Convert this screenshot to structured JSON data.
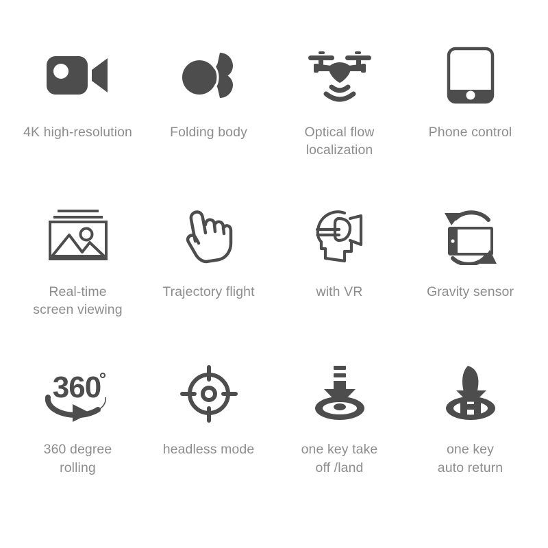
{
  "page": {
    "background_color": "#ffffff",
    "icon_color": "#4d4d4d",
    "label_color": "#8d8d8d"
  },
  "features": [
    {
      "icon": "video-camera-icon",
      "label": "4K high-resolution"
    },
    {
      "icon": "folding-body-icon",
      "label": "Folding body"
    },
    {
      "icon": "drone-optical-flow-icon",
      "label": "Optical flow\nlocalization"
    },
    {
      "icon": "smartphone-icon",
      "label": "Phone control"
    },
    {
      "icon": "image-gallery-icon",
      "label": "Real-time\nscreen viewing"
    },
    {
      "icon": "pointing-hand-icon",
      "label": "Trajectory flight"
    },
    {
      "icon": "vr-headset-head-icon",
      "label": "with VR"
    },
    {
      "icon": "rotate-device-icon",
      "label": "Gravity sensor"
    },
    {
      "icon": "360-degree-rotation-icon",
      "label": "360 degree\nrolling"
    },
    {
      "icon": "crosshair-target-icon",
      "label": "headless mode"
    },
    {
      "icon": "takeoff-land-arrow-icon",
      "label": "one key take\noff /land"
    },
    {
      "icon": "auto-return-helipad-icon",
      "label": "one key\nauto return"
    }
  ]
}
